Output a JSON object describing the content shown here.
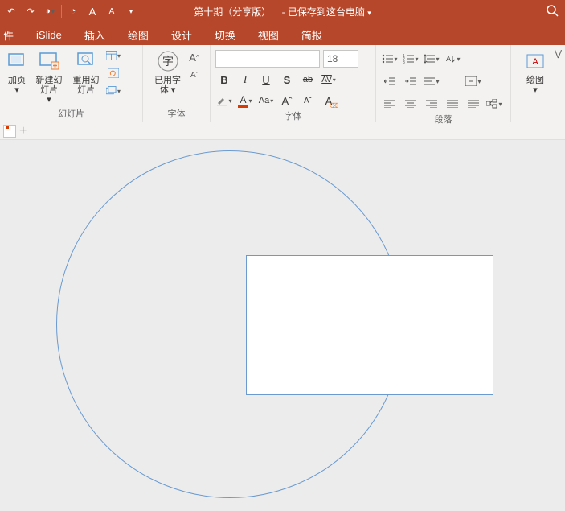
{
  "titlebar": {
    "doc_title": "第十期（分享版）",
    "save_status": "- 已保存到这台电脑",
    "qat": {
      "undo": "↶",
      "redo": "↷",
      "from_beginning": "◑",
      "touch_mode": "◔",
      "font_grow": "A",
      "font_shrink": "A",
      "more": "⋯"
    }
  },
  "tabs": {
    "file": "件",
    "islide": "iSlide",
    "insert": "插入",
    "draw": "绘图",
    "design": "设计",
    "transitions": "切换",
    "view": "视图",
    "brief": "简报"
  },
  "ribbon": {
    "slides": {
      "addpage": "加页",
      "newslide": "新建幻灯片",
      "reuseslide": "重用幻灯片",
      "group_label": "幻灯片"
    },
    "font": {
      "usedfont_line1": "已用字",
      "usedfont_line2": "体",
      "name_placeholder": "",
      "size_value": "18",
      "group_label": "字体"
    },
    "paragraph": {
      "group_label": "段落"
    },
    "drawing": {
      "label": "绘图"
    }
  },
  "icons": {
    "bold": "B",
    "italic": "I",
    "underline": "U",
    "strike": "S",
    "ab": "ab",
    "av": "AV",
    "aa": "Aa",
    "asup": "A",
    "asub": "A",
    "aclear": "A",
    "plus": "+"
  }
}
